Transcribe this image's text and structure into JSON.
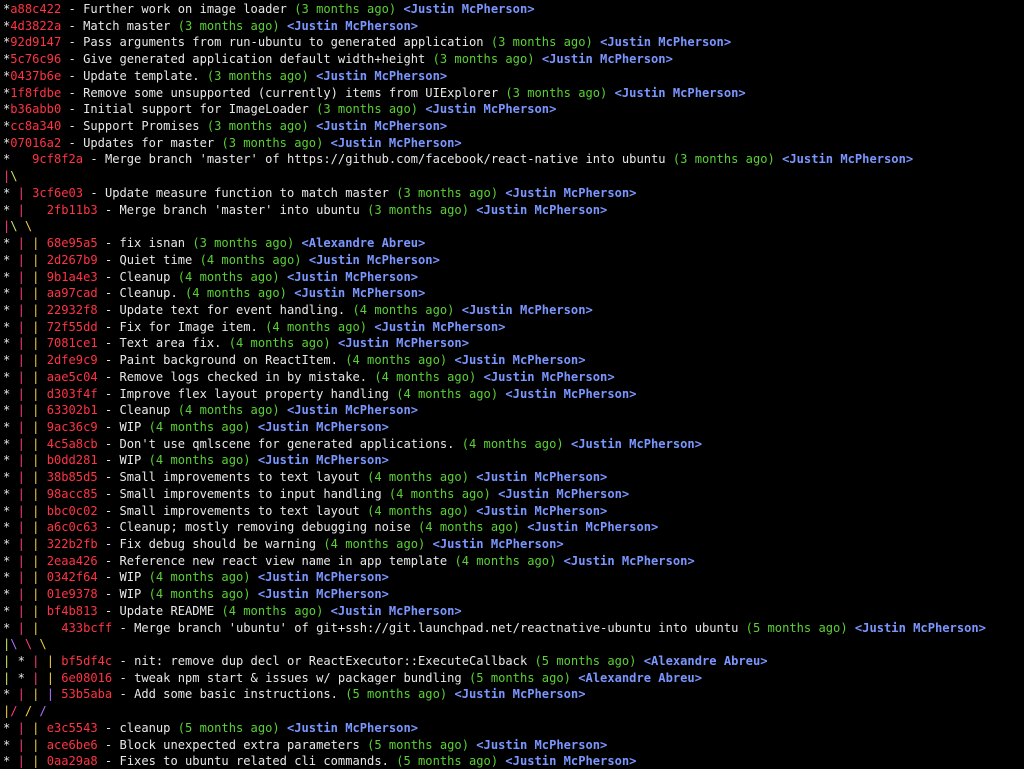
{
  "lines": [
    {
      "graph": [
        [
          "*",
          "white"
        ]
      ],
      "hash": "a88c422",
      "subject": "Further work on image loader",
      "date": "(3 months ago)",
      "author": "<Justin McPherson>"
    },
    {
      "graph": [
        [
          "*",
          "white"
        ]
      ],
      "hash": "4d3822a",
      "subject": "Match master",
      "date": "(3 months ago)",
      "author": "<Justin McPherson>"
    },
    {
      "graph": [
        [
          "*",
          "white"
        ]
      ],
      "hash": "92d9147",
      "subject": "Pass arguments from run-ubuntu to generated application",
      "date": "(3 months ago)",
      "author": "<Justin McPherson>"
    },
    {
      "graph": [
        [
          "*",
          "white"
        ]
      ],
      "hash": "5c76c96",
      "subject": "Give generated application default width+height",
      "date": "(3 months ago)",
      "author": "<Justin McPherson>"
    },
    {
      "graph": [
        [
          "*",
          "white"
        ]
      ],
      "hash": "0437b6e",
      "subject": "Update template.",
      "date": "(3 months ago)",
      "author": "<Justin McPherson>"
    },
    {
      "graph": [
        [
          "*",
          "white"
        ]
      ],
      "hash": "1f8fdbe",
      "subject": "Remove some unsupported (currently) items from UIExplorer",
      "date": "(3 months ago)",
      "author": "<Justin McPherson>"
    },
    {
      "graph": [
        [
          "*",
          "white"
        ]
      ],
      "hash": "b36abb0",
      "subject": "Initial support for ImageLoader",
      "date": "(3 months ago)",
      "author": "<Justin McPherson>"
    },
    {
      "graph": [
        [
          "*",
          "white"
        ]
      ],
      "hash": "cc8a340",
      "subject": "Support Promises",
      "date": "(3 months ago)",
      "author": "<Justin McPherson>"
    },
    {
      "graph": [
        [
          "*",
          "white"
        ]
      ],
      "hash": "07016a2",
      "subject": "Updates for master",
      "date": "(3 months ago)",
      "author": "<Justin McPherson>"
    },
    {
      "graph": [
        [
          "*",
          "white"
        ],
        [
          "   ",
          "white"
        ]
      ],
      "hash": "9cf8f2a",
      "subject": "Merge branch 'master' of https://github.com/facebook/react-native into ubuntu",
      "date": "(3 months ago)",
      "author": "<Justin McPherson>"
    },
    {
      "graph": [
        [
          "|",
          "red"
        ],
        [
          "\\",
          "green"
        ]
      ],
      "hash": "",
      "subject": "",
      "date": "",
      "author": ""
    },
    {
      "graph": [
        [
          "*",
          "white"
        ],
        [
          " ",
          "white"
        ],
        [
          "|",
          "red"
        ],
        " "
      ],
      "hash": "3cf6e03",
      "subject": "Update measure function to match master",
      "date": "(3 months ago)",
      "author": "<Justin McPherson>"
    },
    {
      "graph": [
        [
          "*",
          "white"
        ],
        [
          " ",
          "white"
        ],
        [
          "|",
          "red"
        ],
        [
          "   ",
          "white"
        ]
      ],
      "hash": "2fb11b3",
      "subject": "Merge branch 'master' into ubuntu",
      "date": "(3 months ago)",
      "author": "<Justin McPherson>"
    },
    {
      "graph": [
        [
          "|",
          "red"
        ],
        [
          "\\",
          "green"
        ],
        [
          " ",
          "white"
        ],
        [
          "\\",
          "yellow"
        ]
      ],
      "hash": "",
      "subject": "",
      "date": "",
      "author": ""
    },
    {
      "graph": [
        [
          "*",
          "white"
        ],
        [
          " ",
          "white"
        ],
        [
          "|",
          "red"
        ],
        [
          " ",
          "white"
        ],
        [
          "|",
          "yellow"
        ],
        " "
      ],
      "hash": "68e95a5",
      "subject": "fix isnan",
      "date": "(3 months ago)",
      "author": "<Alexandre Abreu>"
    },
    {
      "graph": [
        [
          "*",
          "white"
        ],
        [
          " ",
          "white"
        ],
        [
          "|",
          "red"
        ],
        [
          " ",
          "white"
        ],
        [
          "|",
          "yellow"
        ],
        " "
      ],
      "hash": "2d267b9",
      "subject": "Quiet time",
      "date": "(4 months ago)",
      "author": "<Justin McPherson>"
    },
    {
      "graph": [
        [
          "*",
          "white"
        ],
        [
          " ",
          "white"
        ],
        [
          "|",
          "red"
        ],
        [
          " ",
          "white"
        ],
        [
          "|",
          "yellow"
        ],
        " "
      ],
      "hash": "9b1a4e3",
      "subject": "Cleanup",
      "date": "(4 months ago)",
      "author": "<Justin McPherson>"
    },
    {
      "graph": [
        [
          "*",
          "white"
        ],
        [
          " ",
          "white"
        ],
        [
          "|",
          "red"
        ],
        [
          " ",
          "white"
        ],
        [
          "|",
          "yellow"
        ],
        " "
      ],
      "hash": "aa97cad",
      "subject": "Cleanup.",
      "date": "(4 months ago)",
      "author": "<Justin McPherson>"
    },
    {
      "graph": [
        [
          "*",
          "white"
        ],
        [
          " ",
          "white"
        ],
        [
          "|",
          "red"
        ],
        [
          " ",
          "white"
        ],
        [
          "|",
          "yellow"
        ],
        " "
      ],
      "hash": "22932f8",
      "subject": "Update text for event handling.",
      "date": "(4 months ago)",
      "author": "<Justin McPherson>"
    },
    {
      "graph": [
        [
          "*",
          "white"
        ],
        [
          " ",
          "white"
        ],
        [
          "|",
          "red"
        ],
        [
          " ",
          "white"
        ],
        [
          "|",
          "yellow"
        ],
        " "
      ],
      "hash": "72f55dd",
      "subject": "Fix for Image item.",
      "date": "(4 months ago)",
      "author": "<Justin McPherson>"
    },
    {
      "graph": [
        [
          "*",
          "white"
        ],
        [
          " ",
          "white"
        ],
        [
          "|",
          "red"
        ],
        [
          " ",
          "white"
        ],
        [
          "|",
          "yellow"
        ],
        " "
      ],
      "hash": "7081ce1",
      "subject": "Text area fix.",
      "date": "(4 months ago)",
      "author": "<Justin McPherson>"
    },
    {
      "graph": [
        [
          "*",
          "white"
        ],
        [
          " ",
          "white"
        ],
        [
          "|",
          "red"
        ],
        [
          " ",
          "white"
        ],
        [
          "|",
          "yellow"
        ],
        " "
      ],
      "hash": "2dfe9c9",
      "subject": "Paint background on ReactItem.",
      "date": "(4 months ago)",
      "author": "<Justin McPherson>"
    },
    {
      "graph": [
        [
          "*",
          "white"
        ],
        [
          " ",
          "white"
        ],
        [
          "|",
          "red"
        ],
        [
          " ",
          "white"
        ],
        [
          "|",
          "yellow"
        ],
        " "
      ],
      "hash": "aae5c04",
      "subject": "Remove logs checked in by mistake.",
      "date": "(4 months ago)",
      "author": "<Justin McPherson>"
    },
    {
      "graph": [
        [
          "*",
          "white"
        ],
        [
          " ",
          "white"
        ],
        [
          "|",
          "red"
        ],
        [
          " ",
          "white"
        ],
        [
          "|",
          "yellow"
        ],
        " "
      ],
      "hash": "d303f4f",
      "subject": "Improve flex layout property handling",
      "date": "(4 months ago)",
      "author": "<Justin McPherson>"
    },
    {
      "graph": [
        [
          "*",
          "white"
        ],
        [
          " ",
          "white"
        ],
        [
          "|",
          "red"
        ],
        [
          " ",
          "white"
        ],
        [
          "|",
          "yellow"
        ],
        " "
      ],
      "hash": "63302b1",
      "subject": "Cleanup",
      "date": "(4 months ago)",
      "author": "<Justin McPherson>"
    },
    {
      "graph": [
        [
          "*",
          "white"
        ],
        [
          " ",
          "white"
        ],
        [
          "|",
          "red"
        ],
        [
          " ",
          "white"
        ],
        [
          "|",
          "yellow"
        ],
        " "
      ],
      "hash": "9ac36c9",
      "subject": "WIP",
      "date": "(4 months ago)",
      "author": "<Justin McPherson>"
    },
    {
      "graph": [
        [
          "*",
          "white"
        ],
        [
          " ",
          "white"
        ],
        [
          "|",
          "red"
        ],
        [
          " ",
          "white"
        ],
        [
          "|",
          "yellow"
        ],
        " "
      ],
      "hash": "4c5a8cb",
      "subject": "Don't use qmlscene for generated applications.",
      "date": "(4 months ago)",
      "author": "<Justin McPherson>"
    },
    {
      "graph": [
        [
          "*",
          "white"
        ],
        [
          " ",
          "white"
        ],
        [
          "|",
          "red"
        ],
        [
          " ",
          "white"
        ],
        [
          "|",
          "yellow"
        ],
        " "
      ],
      "hash": "b0dd281",
      "subject": "WIP",
      "date": "(4 months ago)",
      "author": "<Justin McPherson>"
    },
    {
      "graph": [
        [
          "*",
          "white"
        ],
        [
          " ",
          "white"
        ],
        [
          "|",
          "red"
        ],
        [
          " ",
          "white"
        ],
        [
          "|",
          "yellow"
        ],
        " "
      ],
      "hash": "38b85d5",
      "subject": "Small improvements to text layout",
      "date": "(4 months ago)",
      "author": "<Justin McPherson>"
    },
    {
      "graph": [
        [
          "*",
          "white"
        ],
        [
          " ",
          "white"
        ],
        [
          "|",
          "red"
        ],
        [
          " ",
          "white"
        ],
        [
          "|",
          "yellow"
        ],
        " "
      ],
      "hash": "98acc85",
      "subject": "Small improvements to input handling",
      "date": "(4 months ago)",
      "author": "<Justin McPherson>"
    },
    {
      "graph": [
        [
          "*",
          "white"
        ],
        [
          " ",
          "white"
        ],
        [
          "|",
          "red"
        ],
        [
          " ",
          "white"
        ],
        [
          "|",
          "yellow"
        ],
        " "
      ],
      "hash": "bbc0c02",
      "subject": "Small improvements to text layout",
      "date": "(4 months ago)",
      "author": "<Justin McPherson>"
    },
    {
      "graph": [
        [
          "*",
          "white"
        ],
        [
          " ",
          "white"
        ],
        [
          "|",
          "red"
        ],
        [
          " ",
          "white"
        ],
        [
          "|",
          "yellow"
        ],
        " "
      ],
      "hash": "a6c0c63",
      "subject": "Cleanup; mostly removing debugging noise",
      "date": "(4 months ago)",
      "author": "<Justin McPherson>"
    },
    {
      "graph": [
        [
          "*",
          "white"
        ],
        [
          " ",
          "white"
        ],
        [
          "|",
          "red"
        ],
        [
          " ",
          "white"
        ],
        [
          "|",
          "yellow"
        ],
        " "
      ],
      "hash": "322b2fb",
      "subject": "Fix debug should be warning",
      "date": "(4 months ago)",
      "author": "<Justin McPherson>"
    },
    {
      "graph": [
        [
          "*",
          "white"
        ],
        [
          " ",
          "white"
        ],
        [
          "|",
          "red"
        ],
        [
          " ",
          "white"
        ],
        [
          "|",
          "yellow"
        ],
        " "
      ],
      "hash": "2eaa426",
      "subject": "Reference new react view name in app template",
      "date": "(4 months ago)",
      "author": "<Justin McPherson>"
    },
    {
      "graph": [
        [
          "*",
          "white"
        ],
        [
          " ",
          "white"
        ],
        [
          "|",
          "red"
        ],
        [
          " ",
          "white"
        ],
        [
          "|",
          "yellow"
        ],
        " "
      ],
      "hash": "0342f64",
      "subject": "WIP",
      "date": "(4 months ago)",
      "author": "<Justin McPherson>"
    },
    {
      "graph": [
        [
          "*",
          "white"
        ],
        [
          " ",
          "white"
        ],
        [
          "|",
          "red"
        ],
        [
          " ",
          "white"
        ],
        [
          "|",
          "yellow"
        ],
        " "
      ],
      "hash": "01e9378",
      "subject": "WIP",
      "date": "(4 months ago)",
      "author": "<Justin McPherson>"
    },
    {
      "graph": [
        [
          "*",
          "white"
        ],
        [
          " ",
          "white"
        ],
        [
          "|",
          "red"
        ],
        [
          " ",
          "white"
        ],
        [
          "|",
          "yellow"
        ],
        " "
      ],
      "hash": "bf4b813",
      "subject": "Update README",
      "date": "(4 months ago)",
      "author": "<Justin McPherson>"
    },
    {
      "graph": [
        [
          "*",
          "white"
        ],
        [
          " ",
          "white"
        ],
        [
          "|",
          "red"
        ],
        [
          " ",
          "white"
        ],
        [
          "|",
          "yellow"
        ],
        [
          "   ",
          "white"
        ]
      ],
      "hash": "433bcff",
      "subject": "Merge branch 'ubuntu' of git+ssh://git.launchpad.net/reactnative-ubuntu into ubuntu",
      "date": "(5 months ago)",
      "author": "<Justin McPherson>"
    },
    {
      "graph": [
        [
          "|",
          "green"
        ],
        [
          "\\",
          "purple"
        ],
        [
          " ",
          "white"
        ],
        [
          "\\",
          "red"
        ],
        [
          " ",
          "white"
        ],
        [
          "\\",
          "yellow"
        ]
      ],
      "hash": "",
      "subject": "",
      "date": "",
      "author": ""
    },
    {
      "graph": [
        [
          "|",
          "green"
        ],
        [
          " ",
          "white"
        ],
        [
          "*",
          "white"
        ],
        [
          " ",
          "white"
        ],
        [
          "|",
          "red"
        ],
        [
          " ",
          "white"
        ],
        [
          "|",
          "yellow"
        ],
        " "
      ],
      "hash": "bf5df4c",
      "subject": "nit: remove dup decl or ReactExecutor::ExecuteCallback",
      "date": "(5 months ago)",
      "author": "<Alexandre Abreu>"
    },
    {
      "graph": [
        [
          "|",
          "green"
        ],
        [
          " ",
          "white"
        ],
        [
          "*",
          "white"
        ],
        [
          " ",
          "white"
        ],
        [
          "|",
          "red"
        ],
        [
          " ",
          "white"
        ],
        [
          "|",
          "yellow"
        ],
        " "
      ],
      "hash": "6e08016",
      "subject": "tweak npm start & issues w/ packager bundling",
      "date": "(5 months ago)",
      "author": "<Alexandre Abreu>"
    },
    {
      "graph": [
        [
          "*",
          "white"
        ],
        [
          " ",
          "white"
        ],
        [
          "|",
          "red"
        ],
        [
          " ",
          "white"
        ],
        [
          "|",
          "yellow"
        ],
        [
          " ",
          "white"
        ],
        [
          "|",
          "purple"
        ],
        " "
      ],
      "hash": "53b5aba",
      "subject": "Add some basic instructions.",
      "date": "(5 months ago)",
      "author": "<Justin McPherson>"
    },
    {
      "graph": [
        [
          "|",
          "yellow"
        ],
        [
          "/",
          "red"
        ],
        [
          " ",
          "white"
        ],
        [
          "/",
          "yellow"
        ],
        [
          " ",
          "white"
        ],
        [
          "/",
          "purple"
        ]
      ],
      "hash": "",
      "subject": "",
      "date": "",
      "author": ""
    },
    {
      "graph": [
        [
          "*",
          "white"
        ],
        [
          " ",
          "white"
        ],
        [
          "|",
          "red"
        ],
        [
          " ",
          "white"
        ],
        [
          "|",
          "yellow"
        ],
        " "
      ],
      "hash": "e3c5543",
      "subject": "cleanup",
      "date": "(5 months ago)",
      "author": "<Justin McPherson>"
    },
    {
      "graph": [
        [
          "*",
          "white"
        ],
        [
          " ",
          "white"
        ],
        [
          "|",
          "red"
        ],
        [
          " ",
          "white"
        ],
        [
          "|",
          "yellow"
        ],
        " "
      ],
      "hash": "ace6be6",
      "subject": "Block unexpected extra parameters",
      "date": "(5 months ago)",
      "author": "<Justin McPherson>"
    },
    {
      "graph": [
        [
          "*",
          "white"
        ],
        [
          " ",
          "white"
        ],
        [
          "|",
          "red"
        ],
        [
          " ",
          "white"
        ],
        [
          "|",
          "yellow"
        ],
        " "
      ],
      "hash": "0aa29a8",
      "subject": "Fixes to ubuntu related cli commands.",
      "date": "(5 months ago)",
      "author": "<Justin McPherson>"
    }
  ]
}
